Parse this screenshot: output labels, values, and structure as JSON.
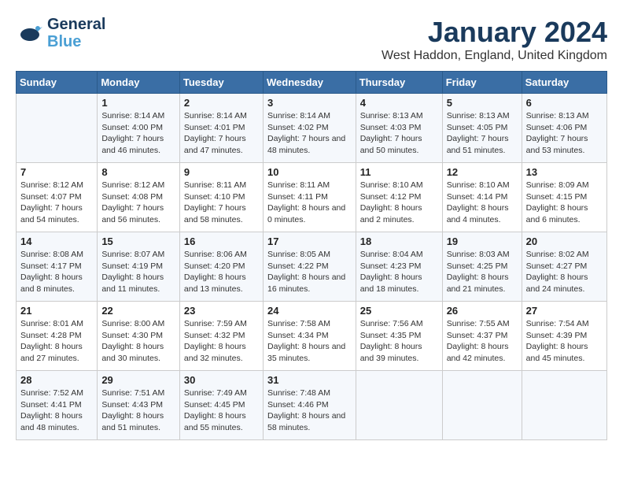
{
  "header": {
    "logo_general": "General",
    "logo_blue": "Blue",
    "month_title": "January 2024",
    "location": "West Haddon, England, United Kingdom"
  },
  "days_of_week": [
    "Sunday",
    "Monday",
    "Tuesday",
    "Wednesday",
    "Thursday",
    "Friday",
    "Saturday"
  ],
  "weeks": [
    [
      {
        "day": "",
        "sunrise": "",
        "sunset": "",
        "daylight": ""
      },
      {
        "day": "1",
        "sunrise": "Sunrise: 8:14 AM",
        "sunset": "Sunset: 4:00 PM",
        "daylight": "Daylight: 7 hours and 46 minutes."
      },
      {
        "day": "2",
        "sunrise": "Sunrise: 8:14 AM",
        "sunset": "Sunset: 4:01 PM",
        "daylight": "Daylight: 7 hours and 47 minutes."
      },
      {
        "day": "3",
        "sunrise": "Sunrise: 8:14 AM",
        "sunset": "Sunset: 4:02 PM",
        "daylight": "Daylight: 7 hours and 48 minutes."
      },
      {
        "day": "4",
        "sunrise": "Sunrise: 8:13 AM",
        "sunset": "Sunset: 4:03 PM",
        "daylight": "Daylight: 7 hours and 50 minutes."
      },
      {
        "day": "5",
        "sunrise": "Sunrise: 8:13 AM",
        "sunset": "Sunset: 4:05 PM",
        "daylight": "Daylight: 7 hours and 51 minutes."
      },
      {
        "day": "6",
        "sunrise": "Sunrise: 8:13 AM",
        "sunset": "Sunset: 4:06 PM",
        "daylight": "Daylight: 7 hours and 53 minutes."
      }
    ],
    [
      {
        "day": "7",
        "sunrise": "Sunrise: 8:12 AM",
        "sunset": "Sunset: 4:07 PM",
        "daylight": "Daylight: 7 hours and 54 minutes."
      },
      {
        "day": "8",
        "sunrise": "Sunrise: 8:12 AM",
        "sunset": "Sunset: 4:08 PM",
        "daylight": "Daylight: 7 hours and 56 minutes."
      },
      {
        "day": "9",
        "sunrise": "Sunrise: 8:11 AM",
        "sunset": "Sunset: 4:10 PM",
        "daylight": "Daylight: 7 hours and 58 minutes."
      },
      {
        "day": "10",
        "sunrise": "Sunrise: 8:11 AM",
        "sunset": "Sunset: 4:11 PM",
        "daylight": "Daylight: 8 hours and 0 minutes."
      },
      {
        "day": "11",
        "sunrise": "Sunrise: 8:10 AM",
        "sunset": "Sunset: 4:12 PM",
        "daylight": "Daylight: 8 hours and 2 minutes."
      },
      {
        "day": "12",
        "sunrise": "Sunrise: 8:10 AM",
        "sunset": "Sunset: 4:14 PM",
        "daylight": "Daylight: 8 hours and 4 minutes."
      },
      {
        "day": "13",
        "sunrise": "Sunrise: 8:09 AM",
        "sunset": "Sunset: 4:15 PM",
        "daylight": "Daylight: 8 hours and 6 minutes."
      }
    ],
    [
      {
        "day": "14",
        "sunrise": "Sunrise: 8:08 AM",
        "sunset": "Sunset: 4:17 PM",
        "daylight": "Daylight: 8 hours and 8 minutes."
      },
      {
        "day": "15",
        "sunrise": "Sunrise: 8:07 AM",
        "sunset": "Sunset: 4:19 PM",
        "daylight": "Daylight: 8 hours and 11 minutes."
      },
      {
        "day": "16",
        "sunrise": "Sunrise: 8:06 AM",
        "sunset": "Sunset: 4:20 PM",
        "daylight": "Daylight: 8 hours and 13 minutes."
      },
      {
        "day": "17",
        "sunrise": "Sunrise: 8:05 AM",
        "sunset": "Sunset: 4:22 PM",
        "daylight": "Daylight: 8 hours and 16 minutes."
      },
      {
        "day": "18",
        "sunrise": "Sunrise: 8:04 AM",
        "sunset": "Sunset: 4:23 PM",
        "daylight": "Daylight: 8 hours and 18 minutes."
      },
      {
        "day": "19",
        "sunrise": "Sunrise: 8:03 AM",
        "sunset": "Sunset: 4:25 PM",
        "daylight": "Daylight: 8 hours and 21 minutes."
      },
      {
        "day": "20",
        "sunrise": "Sunrise: 8:02 AM",
        "sunset": "Sunset: 4:27 PM",
        "daylight": "Daylight: 8 hours and 24 minutes."
      }
    ],
    [
      {
        "day": "21",
        "sunrise": "Sunrise: 8:01 AM",
        "sunset": "Sunset: 4:28 PM",
        "daylight": "Daylight: 8 hours and 27 minutes."
      },
      {
        "day": "22",
        "sunrise": "Sunrise: 8:00 AM",
        "sunset": "Sunset: 4:30 PM",
        "daylight": "Daylight: 8 hours and 30 minutes."
      },
      {
        "day": "23",
        "sunrise": "Sunrise: 7:59 AM",
        "sunset": "Sunset: 4:32 PM",
        "daylight": "Daylight: 8 hours and 32 minutes."
      },
      {
        "day": "24",
        "sunrise": "Sunrise: 7:58 AM",
        "sunset": "Sunset: 4:34 PM",
        "daylight": "Daylight: 8 hours and 35 minutes."
      },
      {
        "day": "25",
        "sunrise": "Sunrise: 7:56 AM",
        "sunset": "Sunset: 4:35 PM",
        "daylight": "Daylight: 8 hours and 39 minutes."
      },
      {
        "day": "26",
        "sunrise": "Sunrise: 7:55 AM",
        "sunset": "Sunset: 4:37 PM",
        "daylight": "Daylight: 8 hours and 42 minutes."
      },
      {
        "day": "27",
        "sunrise": "Sunrise: 7:54 AM",
        "sunset": "Sunset: 4:39 PM",
        "daylight": "Daylight: 8 hours and 45 minutes."
      }
    ],
    [
      {
        "day": "28",
        "sunrise": "Sunrise: 7:52 AM",
        "sunset": "Sunset: 4:41 PM",
        "daylight": "Daylight: 8 hours and 48 minutes."
      },
      {
        "day": "29",
        "sunrise": "Sunrise: 7:51 AM",
        "sunset": "Sunset: 4:43 PM",
        "daylight": "Daylight: 8 hours and 51 minutes."
      },
      {
        "day": "30",
        "sunrise": "Sunrise: 7:49 AM",
        "sunset": "Sunset: 4:45 PM",
        "daylight": "Daylight: 8 hours and 55 minutes."
      },
      {
        "day": "31",
        "sunrise": "Sunrise: 7:48 AM",
        "sunset": "Sunset: 4:46 PM",
        "daylight": "Daylight: 8 hours and 58 minutes."
      },
      {
        "day": "",
        "sunrise": "",
        "sunset": "",
        "daylight": ""
      },
      {
        "day": "",
        "sunrise": "",
        "sunset": "",
        "daylight": ""
      },
      {
        "day": "",
        "sunrise": "",
        "sunset": "",
        "daylight": ""
      }
    ]
  ]
}
